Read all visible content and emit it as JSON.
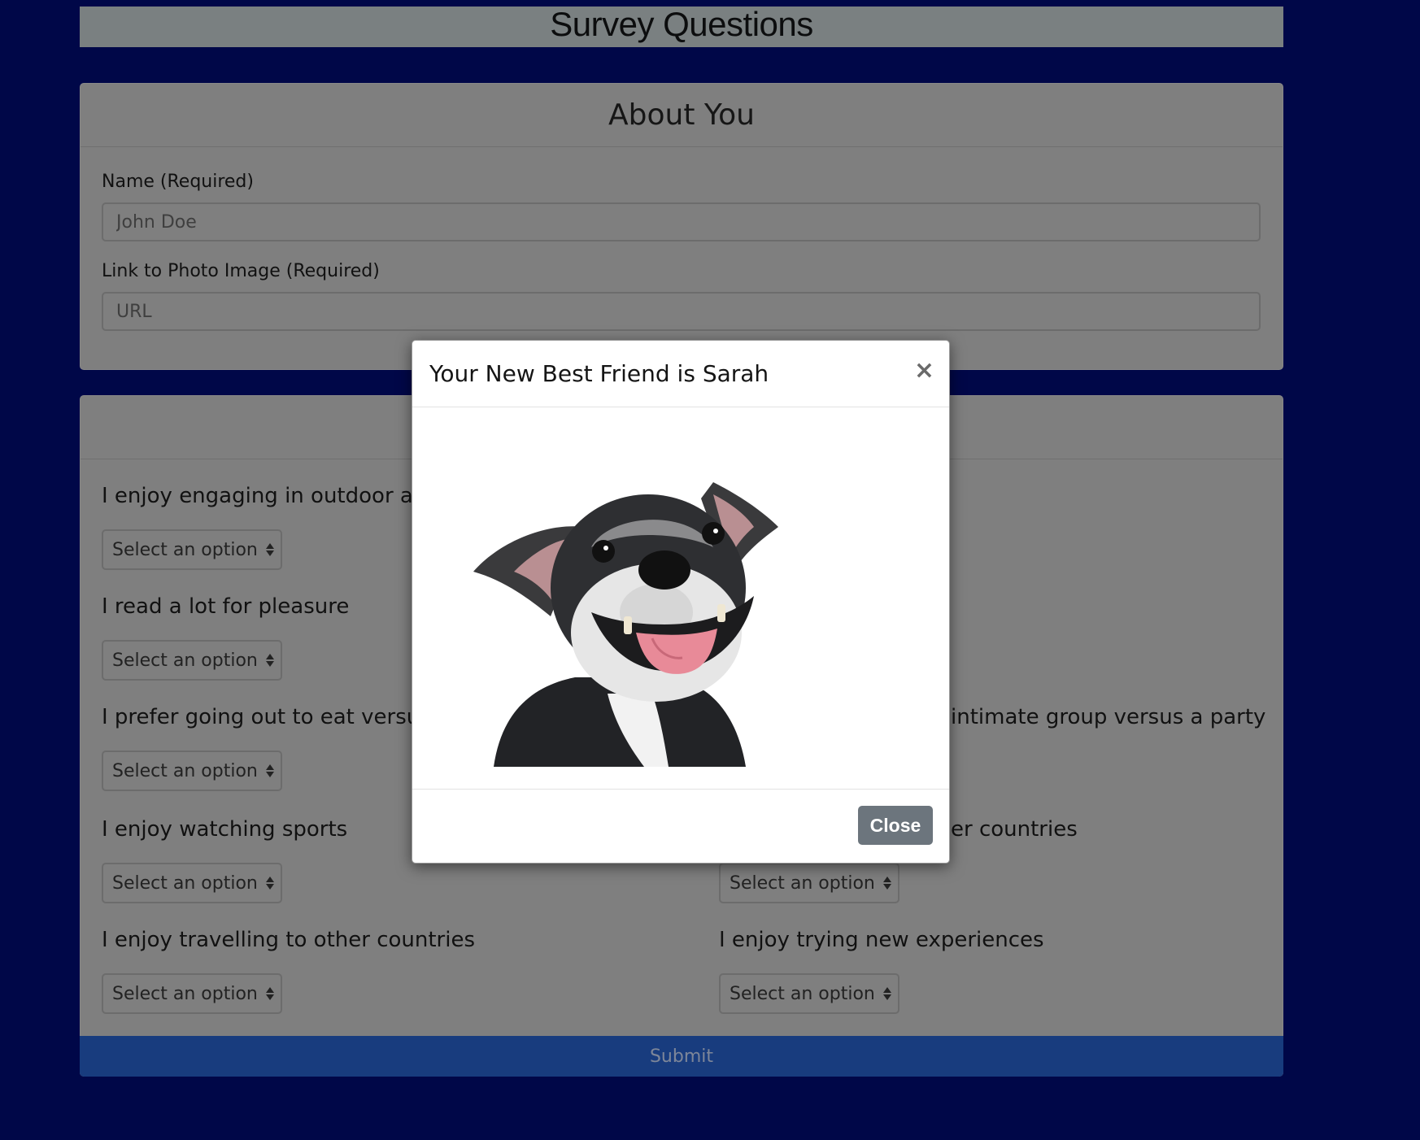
{
  "page": {
    "title": "Survey Questions"
  },
  "about": {
    "heading": "About You",
    "name_label": "Name (Required)",
    "name_placeholder": "John Doe",
    "photo_label": "Link to Photo Image (Required)",
    "photo_placeholder": "URL"
  },
  "questions": {
    "left": [
      {
        "text": "I enjoy engaging in outdoor act",
        "select": "Select an option"
      },
      {
        "text": "I read a lot for pleasure",
        "select": "Select an option"
      },
      {
        "text": "I prefer going out to eat versus",
        "select": "Select an option"
      },
      {
        "text": "I enjoy watching sports",
        "select": "Select an option"
      },
      {
        "text": "I enjoy travelling to other countries",
        "select": "Select an option"
      }
    ],
    "right": [
      {
        "text": "intimate group versus a party"
      },
      {
        "text": "er countries",
        "select": "Select an option"
      },
      {
        "text": "I enjoy trying new experiences",
        "select": "Select an option"
      }
    ]
  },
  "submit_label": "Submit",
  "modal": {
    "title": "Your New Best Friend is Sarah",
    "close_x": "×",
    "close_label": "Close",
    "image_subject": "dog-photo"
  },
  "colors": {
    "background": "#000748",
    "submit": "#183c7e",
    "close_button": "#6c757d"
  }
}
